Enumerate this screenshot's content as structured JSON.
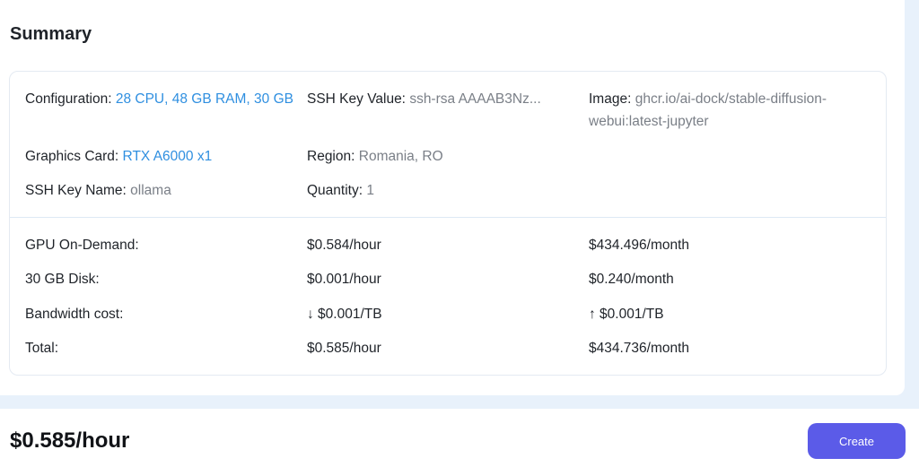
{
  "summary": {
    "title": "Summary",
    "configuration": {
      "label": "Configuration:",
      "value": "28 CPU, 48 GB RAM, 30 GB"
    },
    "ssh_key_value": {
      "label": "SSH Key Value:",
      "value": "ssh-rsa AAAAB3Nz..."
    },
    "image": {
      "label": "Image:",
      "value": "ghcr.io/ai-dock/stable-diffusion-webui:latest-jupyter"
    },
    "graphics_card": {
      "label": "Graphics Card:",
      "value": "RTX A6000 x1"
    },
    "region": {
      "label": "Region:",
      "value": "Romania, RO"
    },
    "ssh_key_name": {
      "label": "SSH Key Name:",
      "value": "ollama"
    },
    "quantity": {
      "label": "Quantity:",
      "value": "1"
    }
  },
  "costs": [
    {
      "label": "GPU On-Demand:",
      "hourly": "$0.584/hour",
      "monthly": "$434.496/month"
    },
    {
      "label": "30 GB Disk:",
      "hourly": "$0.001/hour",
      "monthly": "$0.240/month"
    },
    {
      "label": "Bandwidth cost:",
      "hourly": "↓ $0.001/TB",
      "monthly": "↑ $0.001/TB"
    },
    {
      "label": "Total:",
      "hourly": "$0.585/hour",
      "monthly": "$434.736/month"
    }
  ],
  "footer": {
    "price": "$0.585/hour",
    "create_label": "Create"
  },
  "colors": {
    "accent_blue": "#2f8fe0",
    "button": "#5b5be8",
    "page_bg": "#e8f1fb"
  }
}
